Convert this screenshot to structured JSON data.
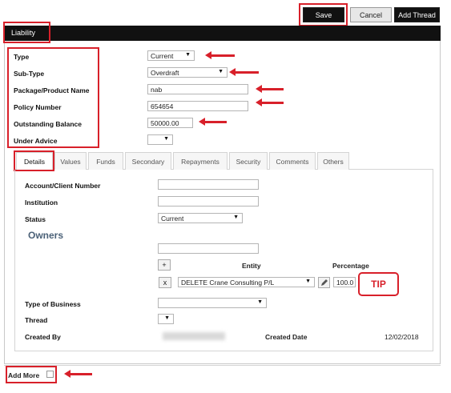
{
  "toolbar": {
    "save_label": "Save",
    "cancel_label": "Cancel",
    "add_thread_label": "Add Thread"
  },
  "section": {
    "title": "Liability"
  },
  "form": {
    "type": {
      "label": "Type",
      "value": "Current"
    },
    "sub_type": {
      "label": "Sub-Type",
      "value": "Overdraft"
    },
    "package_name": {
      "label": "Package/Product Name",
      "value": "nab"
    },
    "policy_number": {
      "label": "Policy Number",
      "value": "654654"
    },
    "outstanding_balance": {
      "label": "Outstanding Balance",
      "value": "50000.00"
    },
    "under_advice": {
      "label": "Under Advice",
      "value": ""
    }
  },
  "tabs": [
    {
      "label": "Details",
      "active": true
    },
    {
      "label": "Values"
    },
    {
      "label": "Funds"
    },
    {
      "label": "Secondary"
    },
    {
      "label": "Repayments"
    },
    {
      "label": "Security"
    },
    {
      "label": "Comments"
    },
    {
      "label": "Others"
    }
  ],
  "details": {
    "account_client_number": {
      "label": "Account/Client Number",
      "value": ""
    },
    "institution": {
      "label": "Institution",
      "value": ""
    },
    "status": {
      "label": "Status",
      "value": "Current"
    },
    "owners_heading": "Owners",
    "owners_table": {
      "entity_header": "Entity",
      "percentage_header": "Percentage",
      "add_symbol": "+",
      "remove_symbol": "x",
      "entity_value": "DELETE Crane Consulting P/L",
      "percentage_value": "100.0"
    },
    "tip_label": "TIP",
    "type_of_business": {
      "label": "Type of Business",
      "value": ""
    },
    "thread": {
      "label": "Thread",
      "value": ""
    },
    "created_by": {
      "label": "Created By"
    },
    "created_date": {
      "label": "Created Date",
      "value": "12/02/2018"
    }
  },
  "footer": {
    "add_more_label": "Add More"
  },
  "colors": {
    "annotation_red": "#d8202a",
    "header_black": "#111111"
  }
}
